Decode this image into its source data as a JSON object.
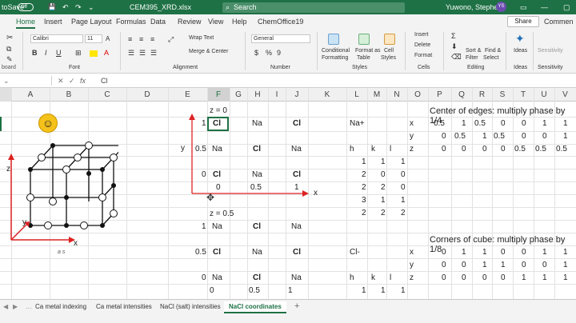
{
  "titlebar": {
    "autosave": "toSave",
    "toggle": "Off",
    "filename": "CEM395_XRD.xlsx",
    "search": "Search",
    "user": "Yuwono, Stephen",
    "initials": "YS"
  },
  "tabs": [
    "Home",
    "Insert",
    "Page Layout",
    "Formulas",
    "Data",
    "Review",
    "View",
    "Help",
    "ChemOffice19"
  ],
  "ribbon_actions": {
    "share": "Share",
    "comments": "Commen"
  },
  "ribbon": {
    "clipboard": "board",
    "font_name": "Calibri",
    "font_size": "11",
    "font_label": "Font",
    "wrap": "Wrap Text",
    "merge": "Merge & Center",
    "alignment": "Alignment",
    "number_format": "General",
    "number": "Number",
    "cond": "Conditional",
    "cond2": "Formatting",
    "fmt_table": "Format as",
    "fmt_table2": "Table",
    "cell_styles": "Cell",
    "cell_styles2": "Styles",
    "styles": "Styles",
    "insert": "Insert",
    "delete": "Delete",
    "format": "Format",
    "cells": "Cells",
    "sort": "Sort &",
    "sort2": "Filter",
    "find": "Find &",
    "find2": "Select",
    "editing": "Editing",
    "ideas": "Ideas",
    "sensitivity": "Sensitivity"
  },
  "formula_bar": {
    "fx": "fx",
    "value": "Cl"
  },
  "columns": [
    "A",
    "B",
    "C",
    "D",
    "E",
    "F",
    "G",
    "H",
    "I",
    "J",
    "K",
    "L",
    "M",
    "N",
    "O",
    "P",
    "Q",
    "R",
    "S",
    "T",
    "U",
    "V"
  ],
  "cells": {
    "z0": "z = 0",
    "z05": "z = 0.5",
    "y_axis": "y",
    "x_axis": "x",
    "r1": [
      "1",
      "Cl",
      "Na",
      "Cl"
    ],
    "r2": [
      "0.5",
      "Na",
      "Cl",
      "Na"
    ],
    "r3": [
      "0",
      "Cl",
      "Na",
      "Cl"
    ],
    "r4": [
      "0",
      "0.5",
      "1"
    ],
    "r5": [
      "1",
      "Na",
      "Cl",
      "Na"
    ],
    "r6": [
      "0.5",
      "Cl",
      "Na",
      "Cl"
    ],
    "r7": [
      "0",
      "Na",
      "Cl",
      "Na"
    ],
    "r8": [
      "0",
      "0.5",
      "1"
    ],
    "na_plus": "Na+",
    "cl_minus": "Cl-",
    "hkl": [
      "h",
      "k",
      "l"
    ],
    "hkl_rows": [
      [
        "1",
        "1",
        "1"
      ],
      [
        "2",
        "0",
        "0"
      ],
      [
        "2",
        "2",
        "0"
      ],
      [
        "3",
        "1",
        "1"
      ],
      [
        "2",
        "2",
        "2"
      ]
    ],
    "hkl_bottom": [
      "h",
      "k",
      "l"
    ],
    "hkl_last": [
      "1",
      "1",
      "1"
    ],
    "edges_title": "Center of edges: multiply phase by 1/4",
    "edges": [
      {
        "label": "x",
        "vals": [
          "0.5",
          "1",
          "0.5",
          "0",
          "0",
          "1",
          "1"
        ]
      },
      {
        "label": "y",
        "vals": [
          "0",
          "0.5",
          "1",
          "0.5",
          "0",
          "0",
          "1"
        ]
      },
      {
        "label": "z",
        "vals": [
          "0",
          "0",
          "0",
          "0",
          "0.5",
          "0.5",
          "0.5"
        ]
      }
    ],
    "corners_title": "Corners of cube: multiply phase by 1/8",
    "corners": [
      {
        "label": "x",
        "vals": [
          "0",
          "1",
          "1",
          "0",
          "0",
          "1",
          "1"
        ]
      },
      {
        "label": "y",
        "vals": [
          "0",
          "0",
          "1",
          "1",
          "0",
          "0",
          "1"
        ]
      },
      {
        "label": "z",
        "vals": [
          "0",
          "0",
          "0",
          "0",
          "1",
          "1",
          "1"
        ]
      }
    ],
    "cube_z": "z",
    "cube_y": "y",
    "cube_x": "x",
    "cube_a": "a s"
  },
  "sheets": [
    "Ca metal indexing",
    "Ca metal intensities",
    "NaCl (salt) intensities",
    "NaCl coordinates"
  ],
  "add_sheet": "+"
}
